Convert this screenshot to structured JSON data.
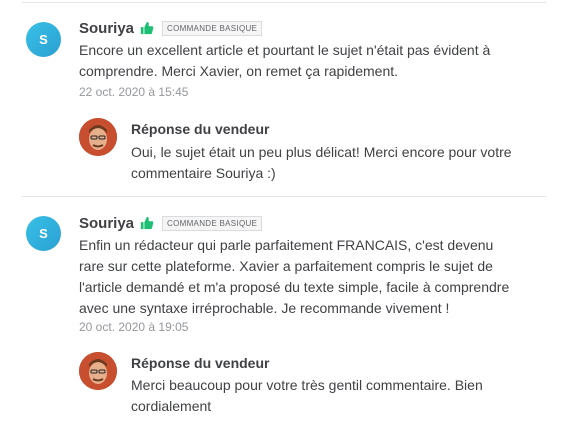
{
  "reviews": [
    {
      "avatar_letter": "S",
      "name": "Souriya",
      "badge": "COMMANDE BASIQUE",
      "comment": "Encore un excellent article et pourtant le sujet n'était pas évident à comprendre. Merci Xavier, on remet ça rapidement.",
      "date": "22 oct. 2020 à 15:45",
      "seller_title": "Réponse du vendeur",
      "seller_response": "Oui, le sujet était un peu plus délicat! Merci encore pour votre commentaire Souriya :)"
    },
    {
      "avatar_letter": "S",
      "name": "Souriya",
      "badge": "COMMANDE BASIQUE",
      "comment": "Enfin un rédacteur qui parle parfaitement FRANCAIS, c'est devenu rare sur cette plateforme. Xavier a parfaitement compris le sujet de l'article demandé et m'a proposé du texte simple, facile à comprendre avec une syntaxe irréprochable. Je recommande vivement !",
      "date": "20 oct. 2020 à 19:05",
      "seller_title": "Réponse du vendeur",
      "seller_response": "Merci beaucoup pour votre très gentil commentaire. Bien cordialement"
    }
  ],
  "icons": {
    "thumb": "thumbs-up-icon"
  },
  "colors": {
    "avatar": "#2a9fd2",
    "thumb": "#1dbf73",
    "text": "#404145",
    "muted": "#95979d"
  }
}
